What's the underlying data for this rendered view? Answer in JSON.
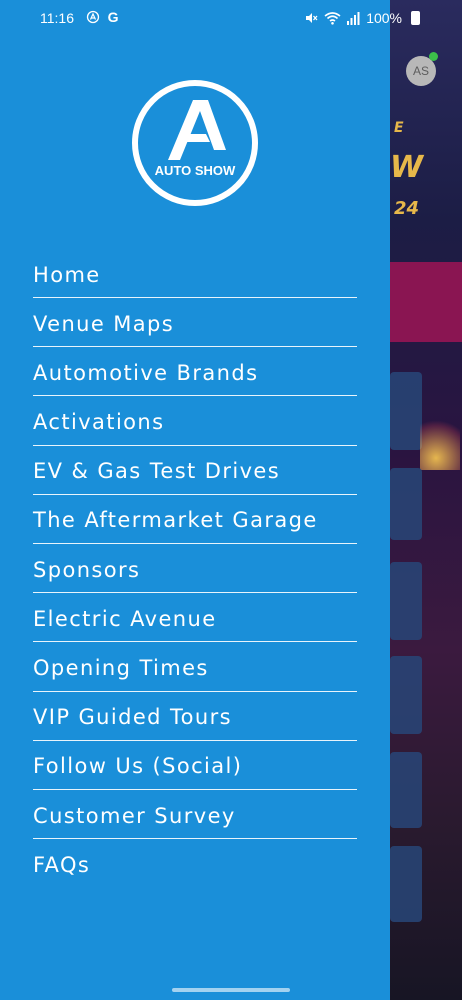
{
  "status_bar": {
    "time": "11:16",
    "left_icons": [
      "alert-icon",
      "google-icon"
    ],
    "google_letter": "G",
    "battery_percent": "100%",
    "right_icons": [
      "mute-icon",
      "wifi-icon",
      "signal-icon",
      "battery-icon"
    ]
  },
  "background_app": {
    "avatar_initials": "AS",
    "headline_line1": "E",
    "headline_line2": "W",
    "headline_line3": "24"
  },
  "drawer": {
    "logo_text": "AUTO SHOW",
    "accent_color": "#1a8fd9",
    "menu": [
      {
        "label": "Home"
      },
      {
        "label": "Venue Maps"
      },
      {
        "label": "Automotive Brands"
      },
      {
        "label": "Activations"
      },
      {
        "label": "EV & Gas Test Drives"
      },
      {
        "label": "The Aftermarket Garage"
      },
      {
        "label": "Sponsors"
      },
      {
        "label": "Electric Avenue"
      },
      {
        "label": "Opening Times"
      },
      {
        "label": "VIP Guided Tours"
      },
      {
        "label": "Follow Us (Social)"
      },
      {
        "label": "Customer Survey"
      },
      {
        "label": "FAQs"
      }
    ]
  }
}
